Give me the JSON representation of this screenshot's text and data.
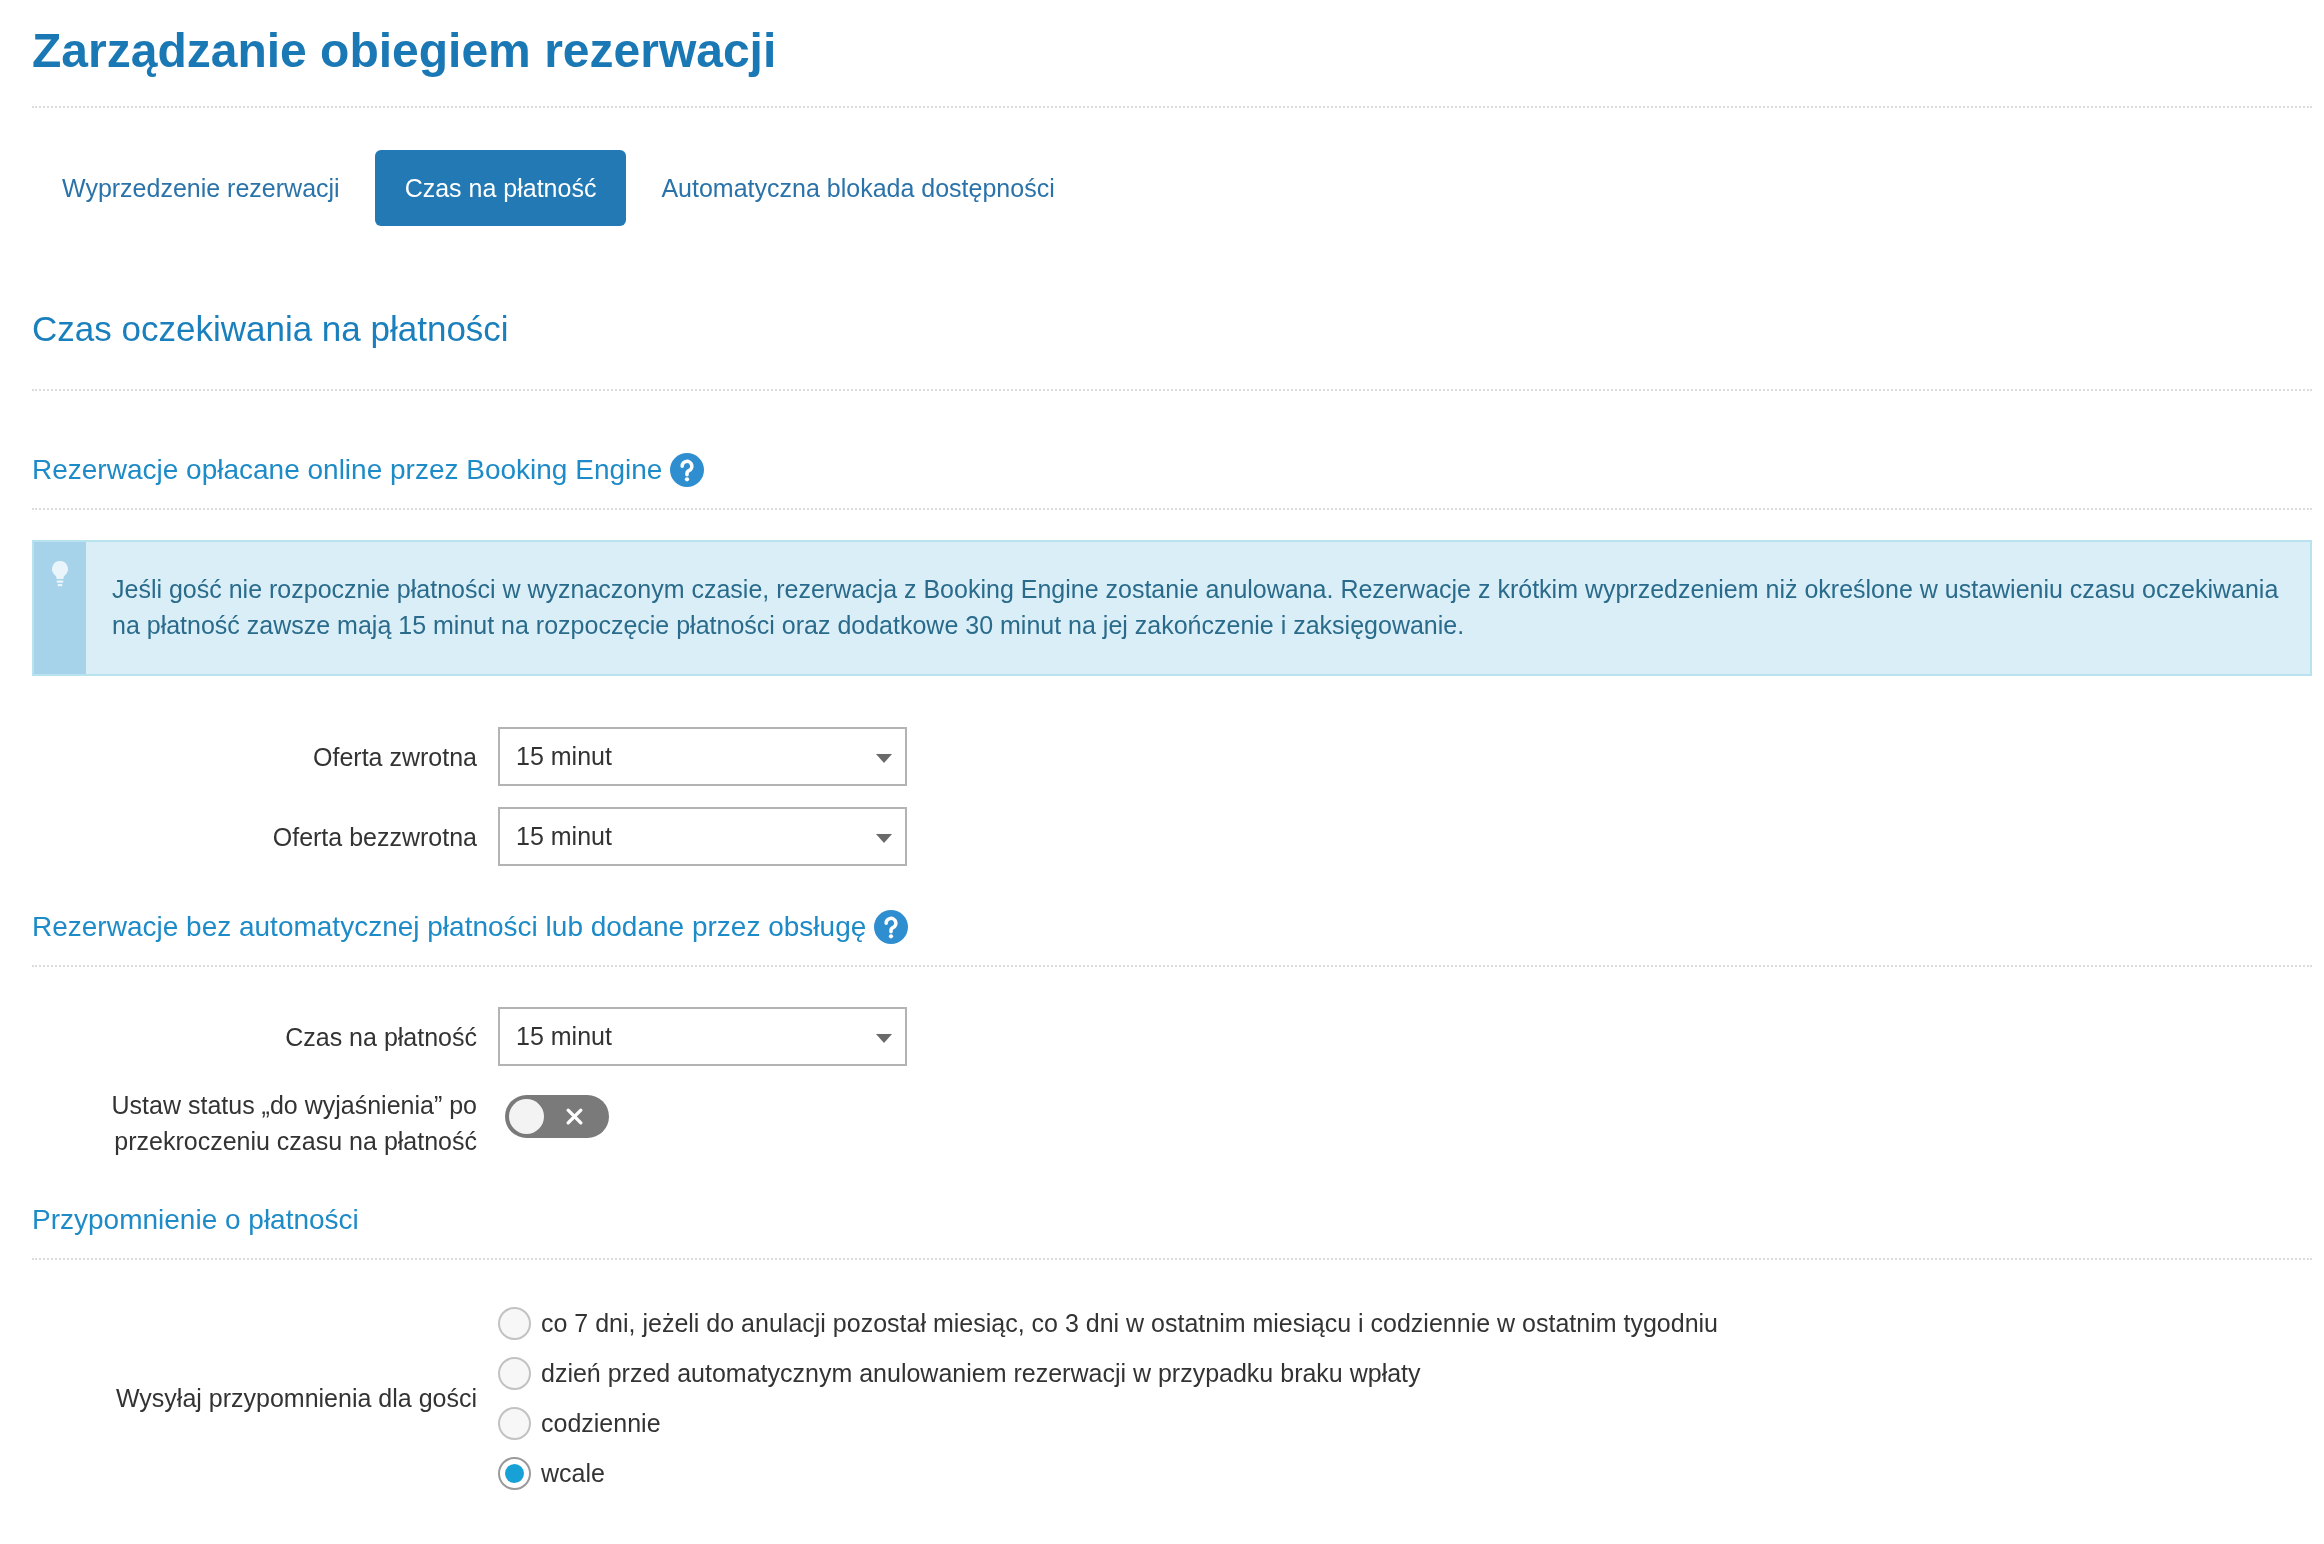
{
  "page": {
    "title": "Zarządzanie obiegiem rezerwacji"
  },
  "tabs": [
    {
      "label": "Wyprzedzenie rezerwacji",
      "selected": false
    },
    {
      "label": "Czas na płatność",
      "selected": true
    },
    {
      "label": "Automatyczna blokada dostępności",
      "selected": false
    }
  ],
  "section": {
    "heading": "Czas oczekiwania na płatności"
  },
  "groups": [
    {
      "heading": "Rezerwacje opłacane online przez Booking Engine",
      "help": true,
      "notice": "Jeśli gość nie rozpocznie płatności w wyznaczonym czasie, rezerwacja z Booking Engine zostanie anulowana. Rezerwacje z krótkim wyprzedzeniem niż określone w ustawieniu czasu oczekiwania na płatność zawsze mają 15 minut na rozpoczęcie płatności oraz dodatkowe 30 minut na jej zakończenie i zaksięgowanie.",
      "fields": [
        {
          "kind": "select",
          "label": "Oferta zwrotna",
          "value": "15 minut"
        },
        {
          "kind": "select",
          "label": "Oferta bezzwrotna",
          "value": "15 minut"
        }
      ]
    },
    {
      "heading": "Rezerwacje bez automatycznej płatności lub dodane przez obsługę",
      "help": true,
      "fields": [
        {
          "kind": "select",
          "label": "Czas na płatność",
          "value": "15 minut"
        },
        {
          "kind": "toggle",
          "label": "Ustaw status „do wyjaśnienia” po przekroczeniu czasu na płatność",
          "on": false
        }
      ]
    },
    {
      "heading": "Przypomnienie o płatności",
      "help": false,
      "fields": [
        {
          "kind": "radio",
          "label": "Wysyłaj przypomnienia dla gości",
          "options": [
            {
              "label": "co 7 dni, jeżeli do anulacji pozostał miesiąc, co 3 dni w ostatnim miesiącu i codziennie w ostatnim tygodniu",
              "selected": false
            },
            {
              "label": "dzień przed automatycznym anulowaniem rezerwacji w przypadku braku wpłaty",
              "selected": false
            },
            {
              "label": "codziennie",
              "selected": false
            },
            {
              "label": "wcale",
              "selected": true
            }
          ]
        }
      ]
    }
  ]
}
